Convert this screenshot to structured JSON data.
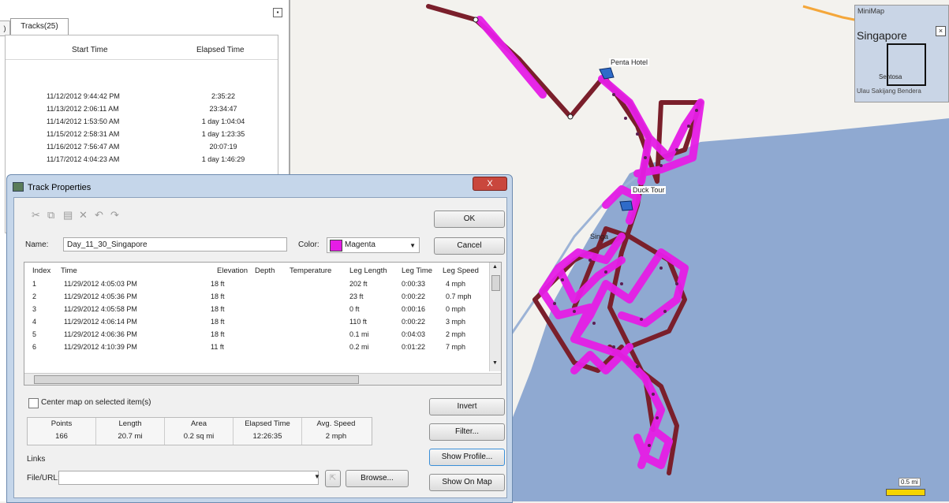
{
  "tracks_panel": {
    "tab_label": "Tracks(25)",
    "columns": [
      "Start Time",
      "Elapsed Time"
    ],
    "rows": [
      {
        "start": "11/12/2012 9:44:42 PM",
        "elapsed": "2:35:22"
      },
      {
        "start": "11/13/2012 2:06:11 AM",
        "elapsed": "23:34:47"
      },
      {
        "start": "11/14/2012 1:53:50 AM",
        "elapsed": "1 day 1:04:04"
      },
      {
        "start": "11/15/2012 2:58:31 AM",
        "elapsed": "1 day 1:23:35"
      },
      {
        "start": "11/16/2012 7:56:47 AM",
        "elapsed": "20:07:19"
      },
      {
        "start": "11/17/2012 4:04:23 AM",
        "elapsed": "1 day 1:46:29"
      }
    ]
  },
  "dialog": {
    "title": "Track Properties",
    "close_label": "X",
    "ok_label": "OK",
    "cancel_label": "Cancel",
    "name_label": "Name:",
    "name_value": "Day_11_30_Singapore",
    "color_label": "Color:",
    "color_value": "Magenta",
    "color_hex": "#e61de6",
    "toolbar_icons": [
      "cut-icon",
      "copy-icon",
      "paste-icon",
      "delete-icon",
      "undo-icon",
      "redo-icon"
    ],
    "grid": {
      "columns": [
        "Index",
        "Time",
        "Elevation",
        "Depth",
        "Temperature",
        "Leg Length",
        "Leg Time",
        "Leg Speed"
      ],
      "rows": [
        {
          "index": "1",
          "time": "11/29/2012 4:05:03 PM",
          "elevation": "18 ft",
          "leg_length": "202 ft",
          "leg_time": "0:00:33",
          "leg_speed": "4 mph"
        },
        {
          "index": "2",
          "time": "11/29/2012 4:05:36 PM",
          "elevation": "18 ft",
          "leg_length": "23 ft",
          "leg_time": "0:00:22",
          "leg_speed": "0.7 mph"
        },
        {
          "index": "3",
          "time": "11/29/2012 4:05:58 PM",
          "elevation": "18 ft",
          "leg_length": "0 ft",
          "leg_time": "0:00:16",
          "leg_speed": "0 mph"
        },
        {
          "index": "4",
          "time": "11/29/2012 4:06:14 PM",
          "elevation": "18 ft",
          "leg_length": "110 ft",
          "leg_time": "0:00:22",
          "leg_speed": "3 mph"
        },
        {
          "index": "5",
          "time": "11/29/2012 4:06:36 PM",
          "elevation": "18 ft",
          "leg_length": "0.1 mi",
          "leg_time": "0:04:03",
          "leg_speed": "2 mph"
        },
        {
          "index": "6",
          "time": "11/29/2012 4:10:39 PM",
          "elevation": "11 ft",
          "leg_length": "0.2 mi",
          "leg_time": "0:01:22",
          "leg_speed": "7 mph"
        }
      ]
    },
    "center_map_label": "Center map on selected item(s)",
    "invert_label": "Invert",
    "filter_label": "Filter...",
    "show_profile_label": "Show Profile...",
    "show_on_map_label": "Show On Map",
    "stats": [
      {
        "label": "Points",
        "value": "166"
      },
      {
        "label": "Length",
        "value": "20.7 mi"
      },
      {
        "label": "Area",
        "value": "0.2 sq mi"
      },
      {
        "label": "Elapsed Time",
        "value": "12:26:35"
      },
      {
        "label": "Avg. Speed",
        "value": "2 mph"
      }
    ],
    "links_label": "Links",
    "file_url_label": "File/URL:",
    "browse_label": "Browse..."
  },
  "map": {
    "poi_labels": {
      "penta": "Penta Hotel",
      "duck": "Duck Tour",
      "singa": "Singa"
    },
    "minimap": {
      "title": "MiniMap",
      "city": "Singapore",
      "sentosa": "Sentosa",
      "pulau": "Ulau Sakijang Bendera"
    },
    "scale_label": "0.5 mi",
    "colors": {
      "water": "#8fa9d1",
      "track": "#e61de6",
      "track_outline": "#7a1f2b"
    }
  }
}
